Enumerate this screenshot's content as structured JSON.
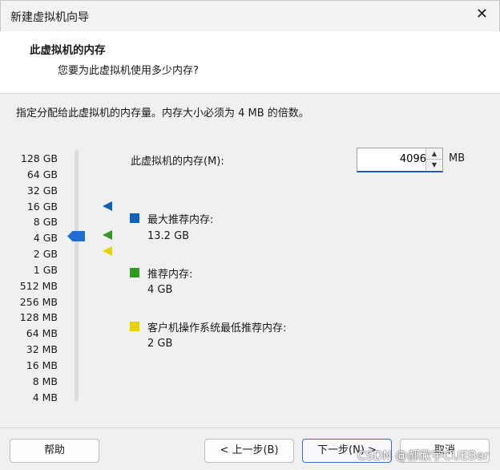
{
  "window": {
    "title": "新建虚拟机向导",
    "close": "✕"
  },
  "header": {
    "title": "此虚拟机的内存",
    "subtitle": "您要为此虚拟机使用多少内存?"
  },
  "hint": "指定分配给此虚拟机的内存量。内存大小必须为 4 MB 的倍数。",
  "memory_sizes": [
    "128 GB",
    "64 GB",
    "32 GB",
    "16 GB",
    "8 GB",
    "4 GB",
    "2 GB",
    "1 GB",
    "512 MB",
    "256 MB",
    "128 MB",
    "64 MB",
    "32 MB",
    "16 MB",
    "8 MB",
    "4 MB"
  ],
  "memory": {
    "label": "此虚拟机的内存(M):",
    "value": "4096",
    "unit": "MB"
  },
  "recommendations": {
    "max": {
      "label": "最大推荐内存:",
      "value": "13.2 GB",
      "color": "#0f62b4"
    },
    "recommended": {
      "label": "推荐内存:",
      "value": "4 GB",
      "color": "#2e9a1e"
    },
    "guest_min": {
      "label": "客户机操作系统最低推荐内存:",
      "value": "2 GB",
      "color": "#e8d200"
    }
  },
  "buttons": {
    "help": "帮助",
    "back": "< 上一步(B)",
    "next": "下一步(N) >",
    "cancel": "取消"
  },
  "watermark": "CSDN @郝欣宇CUEBer"
}
